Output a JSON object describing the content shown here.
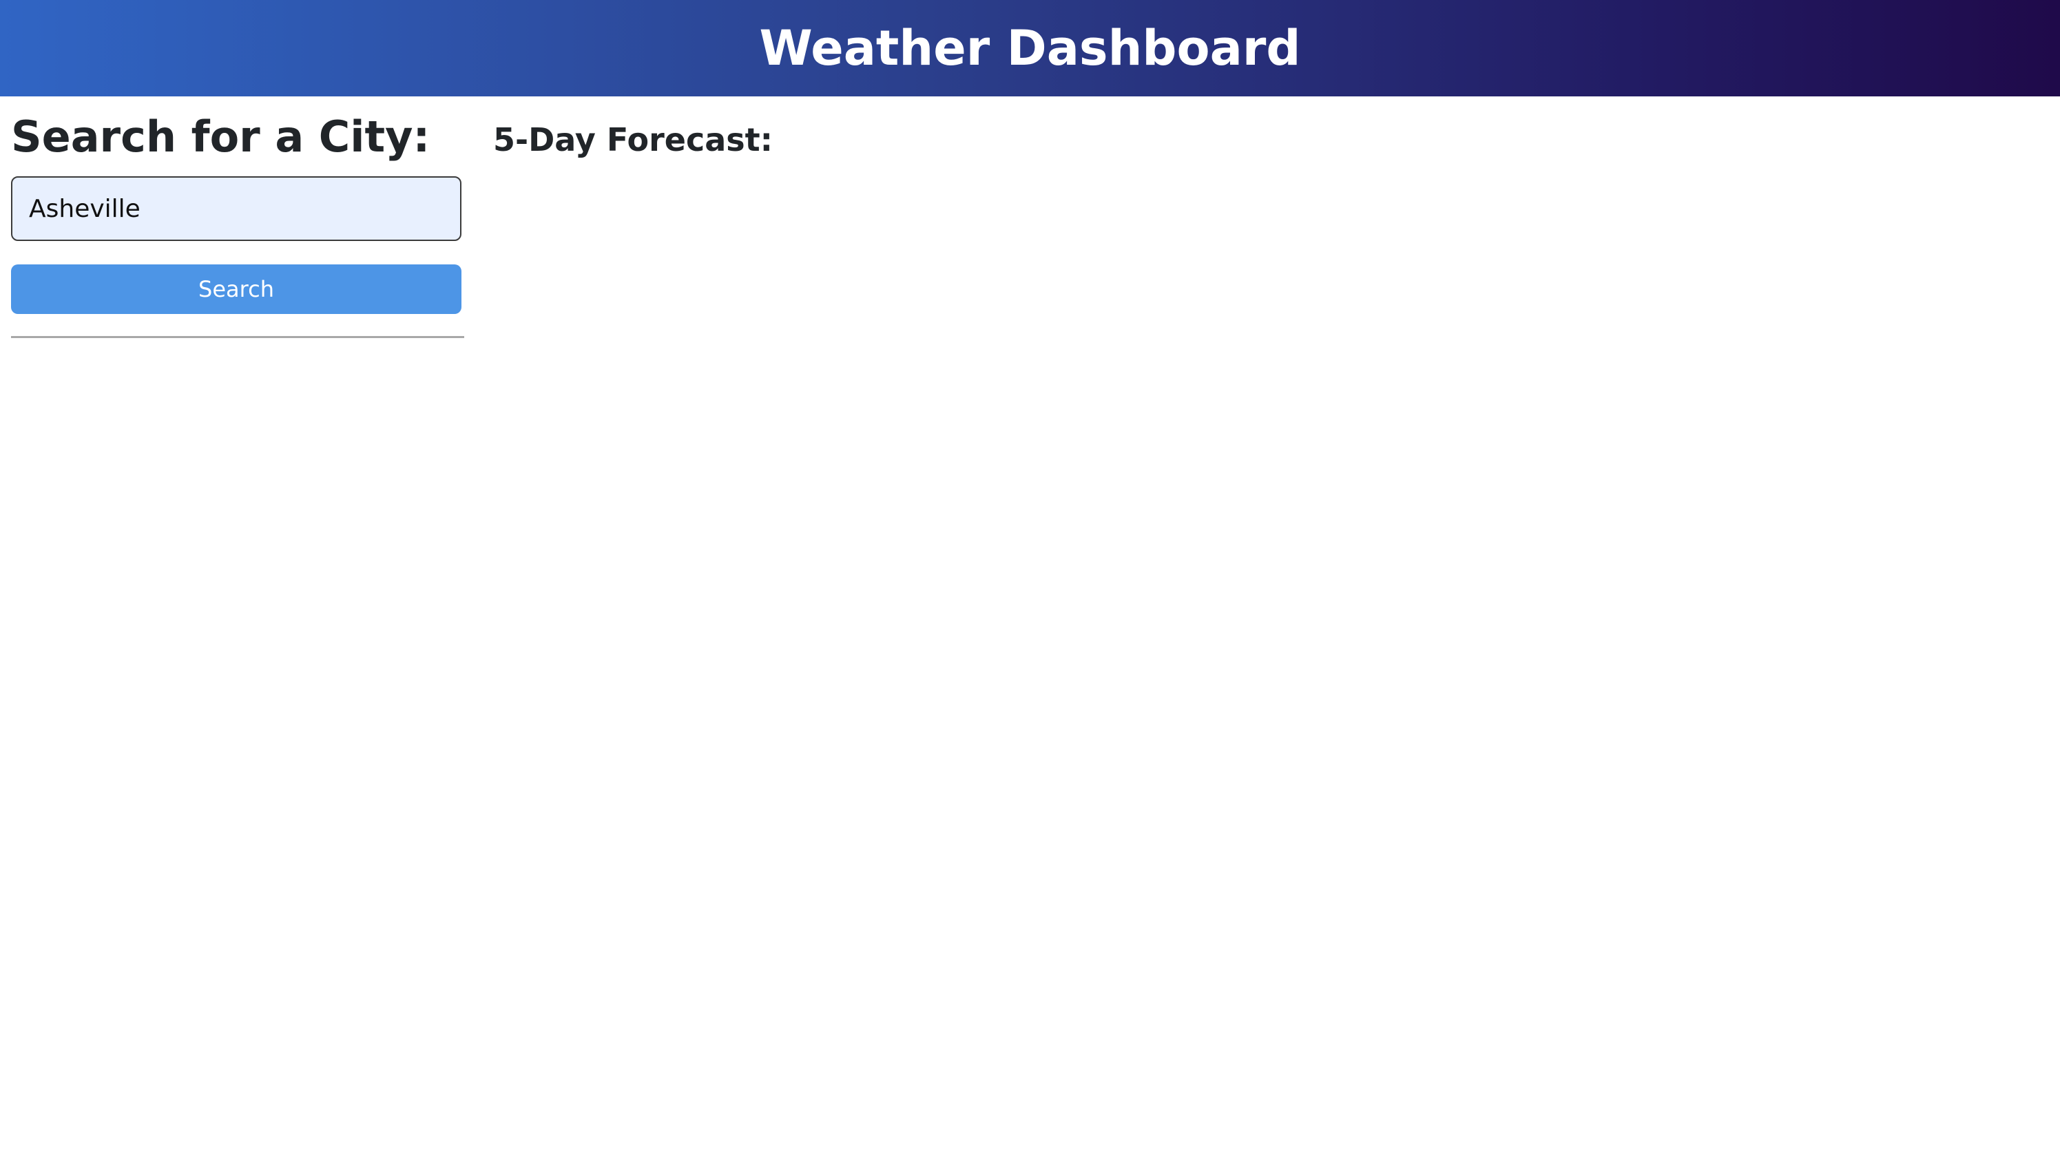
{
  "header": {
    "title": "Weather Dashboard"
  },
  "sidebar": {
    "heading": "Search for a City:",
    "search_input_value": "Asheville",
    "search_button_label": "Search"
  },
  "main": {
    "forecast_heading": "5-Day Forecast:"
  },
  "colors": {
    "header_gradient_start": "#3065c4",
    "header_gradient_end": "#1f0a4a",
    "input_background": "#e8f0fe",
    "search_button": "#4d95e6"
  }
}
